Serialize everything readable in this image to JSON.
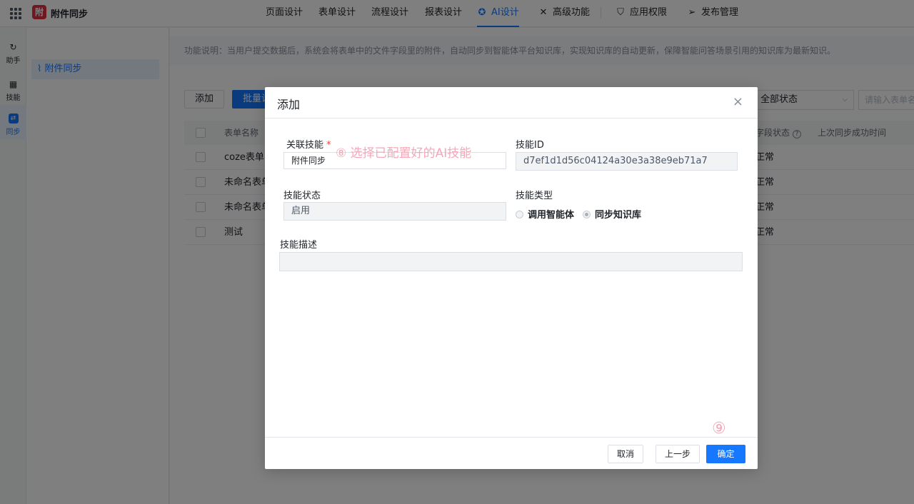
{
  "app": {
    "name": "附件同步",
    "logo_char": "附"
  },
  "nav": [
    {
      "label": "页面设计"
    },
    {
      "label": "表单设计"
    },
    {
      "label": "流程设计"
    },
    {
      "label": "报表设计"
    },
    {
      "label": "AI设计",
      "active": true
    },
    {
      "label": "高级功能"
    },
    {
      "label": "应用权限"
    },
    {
      "label": "发布管理"
    }
  ],
  "rail": [
    {
      "label": "助手"
    },
    {
      "label": "技能"
    },
    {
      "label": "同步",
      "active": true
    }
  ],
  "sidebar": {
    "item": "附件同步"
  },
  "main": {
    "description": "功能说明：当用户提交数据后，系统会将表单中的文件字段里的附件，自动同步到智能体平台知识库，实现知识库的自动更新，保障智能问答场景引用的知识库为最新知识。",
    "add_button": "添加",
    "batch_button": "批量设",
    "status_filter": "全部状态",
    "search_placeholder": "请输入表单名",
    "columns": {
      "form_name": "表单名称",
      "field_status": "字段状态",
      "last_sync": "上次同步成功时间"
    },
    "rows": [
      {
        "name": "coze表单",
        "status": "正常"
      },
      {
        "name": "未命名表单",
        "status": "正常"
      },
      {
        "name": "未命名表单",
        "status": "正常"
      },
      {
        "name": "测试",
        "status": "正常"
      }
    ]
  },
  "modal": {
    "title": "添加",
    "close": "×",
    "linked_skill_label": "关联技能",
    "required_mark": "*",
    "linked_skill_value": "附件同步",
    "hint": "⑧ 选择已配置好的AI技能",
    "skill_id_label": "技能ID",
    "skill_id_value": "d7ef1d1d56c04124a30e3a38e9eb71a7",
    "skill_status_label": "技能状态",
    "skill_status_value": "启用",
    "skill_type_label": "技能类型",
    "type_option_agent": "调用智能体",
    "type_option_kb": "同步知识库",
    "skill_desc_label": "技能描述",
    "skill_desc_value": "",
    "cancel": "取消",
    "prev": "上一步",
    "confirm": "确定",
    "step9": "⑨"
  },
  "colors": {
    "accent": "#1677ff",
    "annotation": "#f5a7b8",
    "logo": "#e02e41"
  }
}
